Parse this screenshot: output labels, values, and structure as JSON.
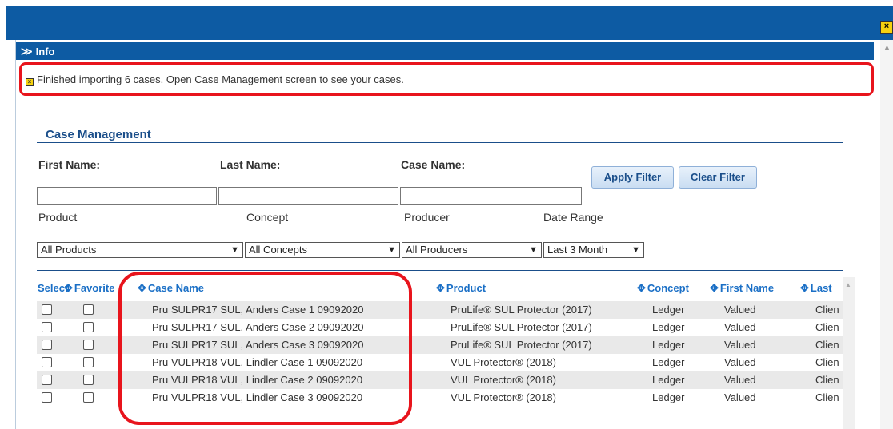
{
  "topbar": {
    "close_glyph": "×"
  },
  "info": {
    "title": "Info",
    "chevron": "≫",
    "message": "Finished importing 6 cases. Open Case Management screen to see your cases.",
    "warn_glyph": "×"
  },
  "case_management": {
    "title": "Case Management",
    "filters": {
      "first_name_label": "First Name:",
      "last_name_label": "Last Name:",
      "case_name_label": "Case Name:",
      "first_name_value": "",
      "last_name_value": "",
      "case_name_value": "",
      "apply_label": "Apply Filter",
      "clear_label": "Clear Filter"
    },
    "selects": {
      "product_label": "Product",
      "concept_label": "Concept",
      "producer_label": "Producer",
      "date_range_label": "Date Range",
      "product_value": "All Products",
      "concept_value": "All Concepts",
      "producer_value": "All Producers",
      "date_range_value": "Last 3 Month"
    },
    "table": {
      "columns": {
        "select": "Select",
        "favorite": "Favorite",
        "case_name": "Case Name",
        "product": "Product",
        "concept": "Concept",
        "first_name": "First Name",
        "last_name": "Last"
      },
      "rows": [
        {
          "case_name": "Pru SULPR17 SUL, Anders Case 1 09092020",
          "product": "PruLife® SUL Protector (2017)",
          "concept": "Ledger",
          "first_name": "Valued",
          "last_name": "Clien"
        },
        {
          "case_name": "Pru SULPR17 SUL, Anders Case 2 09092020",
          "product": "PruLife® SUL Protector (2017)",
          "concept": "Ledger",
          "first_name": "Valued",
          "last_name": "Clien"
        },
        {
          "case_name": "Pru SULPR17 SUL, Anders Case 3 09092020",
          "product": "PruLife® SUL Protector (2017)",
          "concept": "Ledger",
          "first_name": "Valued",
          "last_name": "Clien"
        },
        {
          "case_name": "Pru VULPR18 VUL, Lindler Case 1 09092020",
          "product": "VUL Protector® (2018)",
          "concept": "Ledger",
          "first_name": "Valued",
          "last_name": "Clien"
        },
        {
          "case_name": "Pru VULPR18 VUL, Lindler Case 2 09092020",
          "product": "VUL Protector® (2018)",
          "concept": "Ledger",
          "first_name": "Valued",
          "last_name": "Clien"
        },
        {
          "case_name": "Pru VULPR18 VUL, Lindler Case 3 09092020",
          "product": "VUL Protector® (2018)",
          "concept": "Ledger",
          "first_name": "Valued",
          "last_name": "Clien"
        }
      ]
    }
  },
  "colors": {
    "brand": "#0d5ba3",
    "link": "#1a6fc6",
    "highlight": "#e8141c",
    "warn": "#f5d20f",
    "stripe": "#e9e9e9"
  }
}
